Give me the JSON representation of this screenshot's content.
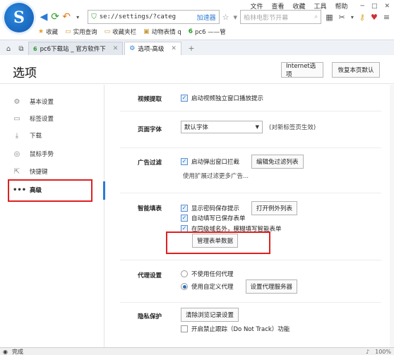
{
  "menubar": {
    "items": [
      "文件",
      "查看",
      "收藏",
      "工具",
      "帮助"
    ]
  },
  "nav": {
    "url": "se://settings/?categ",
    "speed_label": "加速器",
    "search_placeholder": "柏林电影节开幕"
  },
  "bookmarks": [
    "收藏",
    "实用查询",
    "收藏夹栏",
    "动物表情 q",
    "pc6 ——管"
  ],
  "tabs": [
    {
      "label": "pc6下载站 _ 官方软件下",
      "active": false,
      "favicon": "p6"
    },
    {
      "label": "选项-高级",
      "active": true,
      "favicon": "gear"
    }
  ],
  "header": {
    "title": "选项",
    "internet_button": "Internet选项",
    "reset_button": "恢复本页默认"
  },
  "sidebar": {
    "items": [
      {
        "label": "基本设置",
        "icon": "gear-icon"
      },
      {
        "label": "标签设置",
        "icon": "tab-icon"
      },
      {
        "label": "下载",
        "icon": "download-icon"
      },
      {
        "label": "鼠标手势",
        "icon": "mouse-icon"
      },
      {
        "label": "快捷键",
        "icon": "shortcut-icon"
      },
      {
        "label": "高级",
        "icon": "more-icon",
        "active": true
      }
    ]
  },
  "sections": {
    "video": {
      "label": "视频提取",
      "option": "启动视频独立窗口播放提示",
      "checked": true
    },
    "font": {
      "label": "页面字体",
      "selected": "默认字体",
      "hint": "(对新标签页生效)"
    },
    "adblock": {
      "label": "广告过滤",
      "option": "启动弹出窗口拦截",
      "checked": true,
      "button": "编辑免过滤列表",
      "note": "使用扩展过滤更多广告..."
    },
    "autofill": {
      "label": "智能填表",
      "options": [
        {
          "label": "显示密码保存提示",
          "checked": true
        },
        {
          "label": "自动填写已保存表单",
          "checked": true
        },
        {
          "label": "在同级域名外，模糊填写智能表单",
          "checked": true
        }
      ],
      "exceptions_button": "打开例外列表",
      "manage_button": "管理表单数据"
    },
    "proxy": {
      "label": "代理设置",
      "options": [
        {
          "label": "不使用任何代理",
          "selected": false
        },
        {
          "label": "使用自定义代理",
          "selected": true
        }
      ],
      "button": "设置代理服务器"
    },
    "privacy": {
      "label": "隐私保护",
      "button": "清除浏览记录设置",
      "dnt_option": "开启禁止跟踪（Do Not Track）功能",
      "dnt_checked": false
    }
  },
  "statusbar": {
    "text": "完成",
    "zoom": "100%"
  },
  "colors": {
    "highlight": "#e02020",
    "accent": "#2a7bd4"
  }
}
